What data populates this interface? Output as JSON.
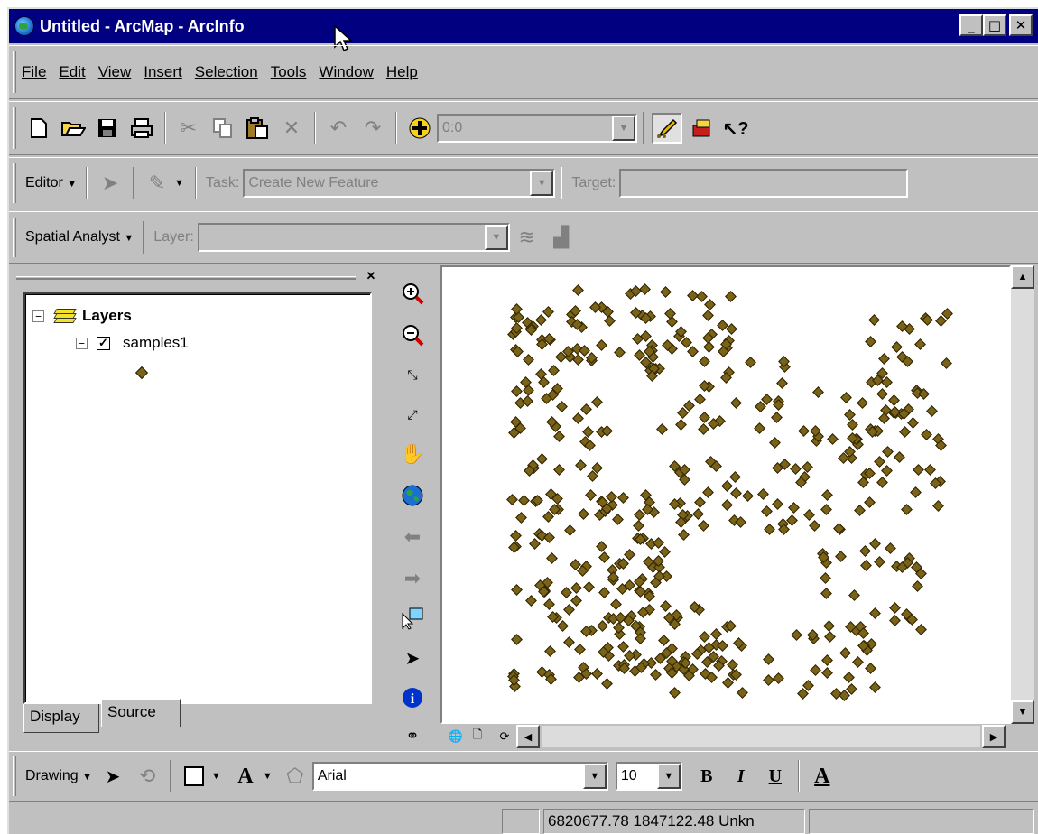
{
  "window": {
    "title": "Untitled - ArcMap - ArcInfo",
    "controls": {
      "minimize": "_",
      "maximize": "□",
      "close": "✕"
    }
  },
  "menu": {
    "items": [
      "File",
      "Edit",
      "View",
      "Insert",
      "Selection",
      "Tools",
      "Window",
      "Help"
    ],
    "mnemonic_index": [
      0,
      0,
      0,
      0,
      0,
      0,
      0,
      0
    ]
  },
  "standard_toolbar": {
    "scale_value": "0:0"
  },
  "editor_toolbar": {
    "editor_label": "Editor",
    "task_label": "Task:",
    "task_value": "Create New Feature",
    "target_label": "Target:",
    "target_value": ""
  },
  "spatial_toolbar": {
    "label": "Spatial Analyst",
    "layer_label": "Layer:",
    "layer_value": ""
  },
  "toc": {
    "root_label": "Layers",
    "layer_name": "samples1",
    "layer_checked": true,
    "tabs": [
      "Display",
      "Source"
    ],
    "active_tab": "Display"
  },
  "drawing_toolbar": {
    "label": "Drawing",
    "font_value": "Arial",
    "size_value": "10",
    "bold": "B",
    "italic": "I",
    "underline": "U",
    "font_color_glyph": "A"
  },
  "status": {
    "coordinates": "6820677.78  1847122.48 Unkn"
  },
  "colors": {
    "title_bar": "#000080",
    "face": "#c0c0c0",
    "point_fill": "#7a6318"
  },
  "icons": {
    "tools": [
      "zoom-in-icon",
      "zoom-out-icon",
      "fixed-zoom-in-icon",
      "fixed-zoom-out-icon",
      "pan-hand-icon",
      "full-extent-globe-icon",
      "back-extent-icon",
      "forward-extent-icon",
      "select-features-icon",
      "select-elements-icon",
      "identify-icon",
      "find-icon"
    ]
  }
}
